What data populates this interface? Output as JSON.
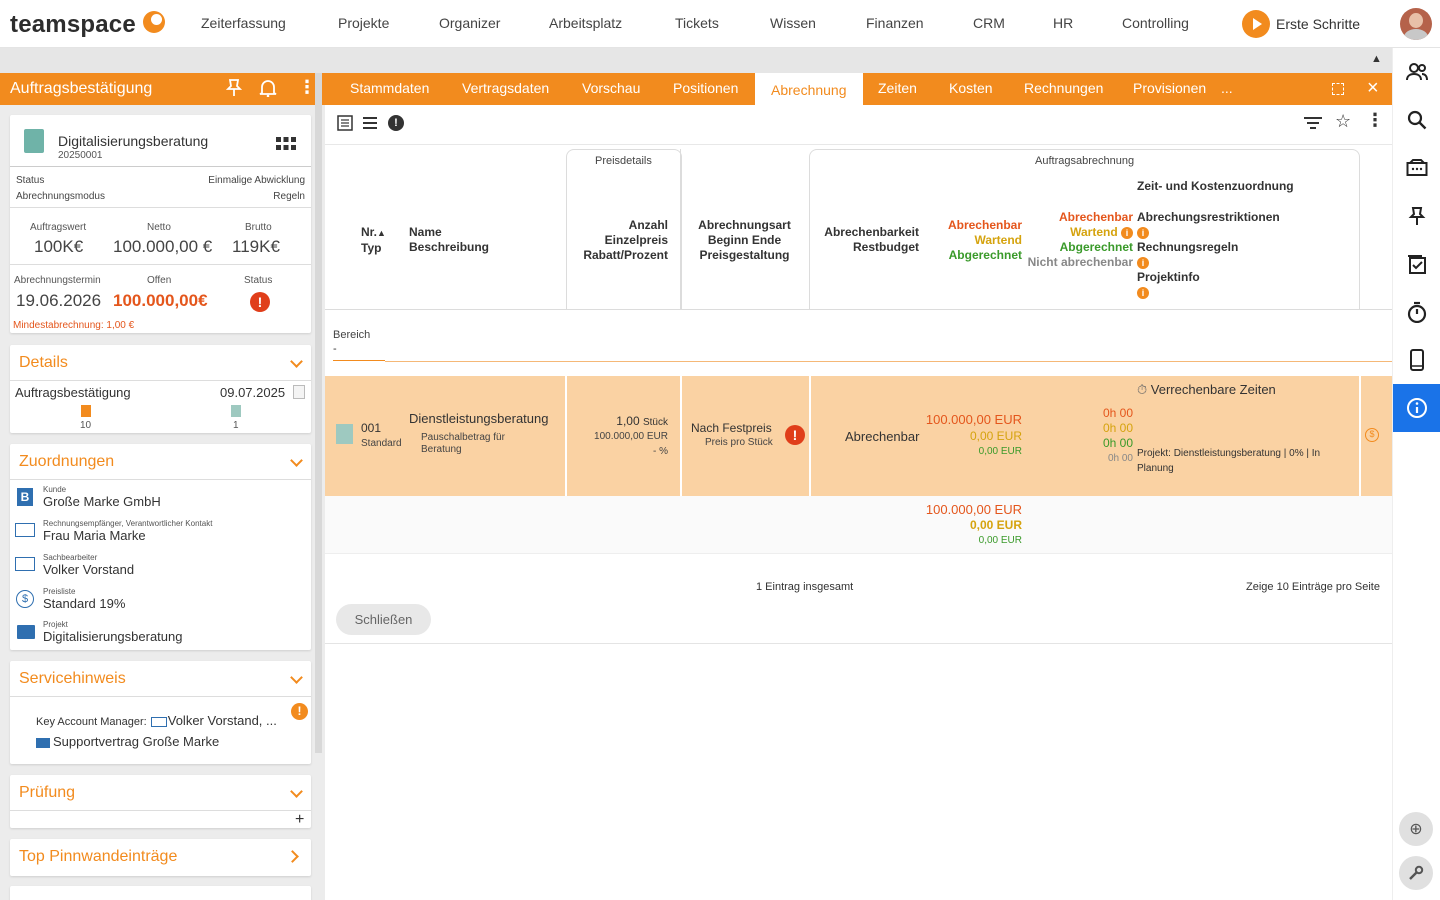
{
  "app": {
    "brand": "teamspace"
  },
  "topnav": {
    "items": [
      "Zeiterfassung",
      "Projekte",
      "Organizer",
      "Arbeitsplatz",
      "Tickets",
      "Wissen",
      "Finanzen",
      "CRM",
      "HR",
      "Controlling"
    ],
    "erste_schritte": "Erste Schritte"
  },
  "left": {
    "title": "Auftragsbestätigung",
    "summary": {
      "name": "Digitalisierungsberatung",
      "number": "20250001",
      "status_label": "Status",
      "status_value": "Einmalige Abwicklung",
      "modus_label": "Abrechnungsmodus",
      "modus_value": "Regeln",
      "auftragswert_label": "Auftragswert",
      "auftragswert": "100K€",
      "netto_label": "Netto",
      "netto": "100.000,00 €",
      "brutto_label": "Brutto",
      "brutto": "119K€",
      "termin_label": "Abrechnungstermin",
      "termin": "19.06.2026",
      "offen_label": "Offen",
      "offen": "100.000,00€",
      "status2_label": "Status",
      "mindest": "Mindestabrechnung: 1,00 €"
    },
    "details": {
      "title": "Details",
      "doc": "Auftragsbestätigung",
      "date": "09.07.2025",
      "count1": "10",
      "count2": "1"
    },
    "zuordnungen": {
      "title": "Zuordnungen",
      "items": [
        {
          "label": "Kunde",
          "value": "Große Marke GmbH"
        },
        {
          "label": "Rechnungsempfänger, Verantwortlicher Kontakt",
          "value": "Frau Maria Marke"
        },
        {
          "label": "Sachbearbeiter",
          "value": "Volker Vorstand"
        },
        {
          "label": "Preisliste",
          "value": "Standard 19%"
        },
        {
          "label": "Projekt",
          "value": "Digitalisierungsberatung"
        }
      ]
    },
    "service": {
      "title": "Servicehinweis",
      "kam_label": "Key Account Manager:",
      "kam_value": "Volker Vorstand, ...",
      "vertrag": "Supportvertrag Große Marke"
    },
    "pruefung": {
      "title": "Prüfung",
      "plus": "+"
    },
    "pinnwand": {
      "title": "Top Pinnwandeinträge"
    }
  },
  "tabs": [
    "Stammdaten",
    "Vertragsdaten",
    "Vorschau",
    "Positionen",
    "Abrechnung",
    "Zeiten",
    "Kosten",
    "Rechnungen",
    "Provisionen",
    "..."
  ],
  "active_tab": "Abrechnung",
  "table": {
    "group_preis": "Preisdetails",
    "group_auftrag": "Auftragsabrechnung",
    "h_nr": "Nr.",
    "h_nr_arrow": "▲",
    "h_typ": "Typ",
    "h_name": "Name",
    "h_beschreibung": "Beschreibung",
    "h_anzahl": "Anzahl",
    "h_einzelpreis": "Einzelpreis",
    "h_rabatt": "Rabatt/Prozent",
    "h_abrechnungsart": "Abrechnungsart",
    "h_beginn": "Beginn Ende",
    "h_preisgestaltung": "Preisgestaltung",
    "h_abrechenbarkeit": "Abrechenbarkeit",
    "h_restbudget": "Restbudget",
    "h_abrechenbar": "Abrechenbar",
    "h_wartend": "Wartend",
    "h_abgerechnet": "Abgerechnet",
    "h_nicht": "Nicht abrechenbar",
    "h_zeitkosten": "Zeit- und Kostenzuordnung",
    "h_restriktionen": "Abrechungsrestriktionen",
    "h_regeln": "Rechnungsregeln",
    "h_projektinfo": "Projektinfo",
    "filter_label": "Bereich",
    "filter_value": "-",
    "row": {
      "nr": "001",
      "typ": "Standard",
      "name": "Dienstleistungsberatung",
      "beschreibung": "Pauschalbetrag für Beratung",
      "anzahl": "1,00",
      "einheit": "Stück",
      "einzelpreis": "100.000,00 EUR",
      "rabatt": "- %",
      "abrechnungsart": "Nach Festpreis",
      "preis_pro": "Preis pro Stück",
      "abrechenbarkeit": "Abrechenbar",
      "abrechenbar_eur": "100.000,00 EUR",
      "wartend_eur": "0,00 EUR",
      "abgerechnet_eur": "0,00 EUR",
      "h1": "0h 00",
      "h2": "0h 00",
      "h3": "0h 00",
      "h4": "0h 00",
      "verrechenbar": "Verrechenbare Zeiten",
      "projekt_label": "Projekt:",
      "projekt_value": "Dienstleistungsberatung | 0% | In Planung"
    },
    "totals": {
      "abrechenbar": "100.000,00 EUR",
      "wartend": "0,00 EUR",
      "abgerechnet": "0,00 EUR"
    },
    "footer_count": "1 Eintrag insgesamt",
    "footer_pager_pre": "Zeige",
    "footer_pager_n": "10",
    "footer_pager_post": "Einträge pro Seite"
  },
  "close_button": "Schließen",
  "colors": {
    "accent": "#f28b1e",
    "row": "#fad2a3",
    "red": "#e4561c",
    "yellow": "#d5a30e",
    "green": "#3a9a2a",
    "active_rail": "#1a73e8"
  }
}
